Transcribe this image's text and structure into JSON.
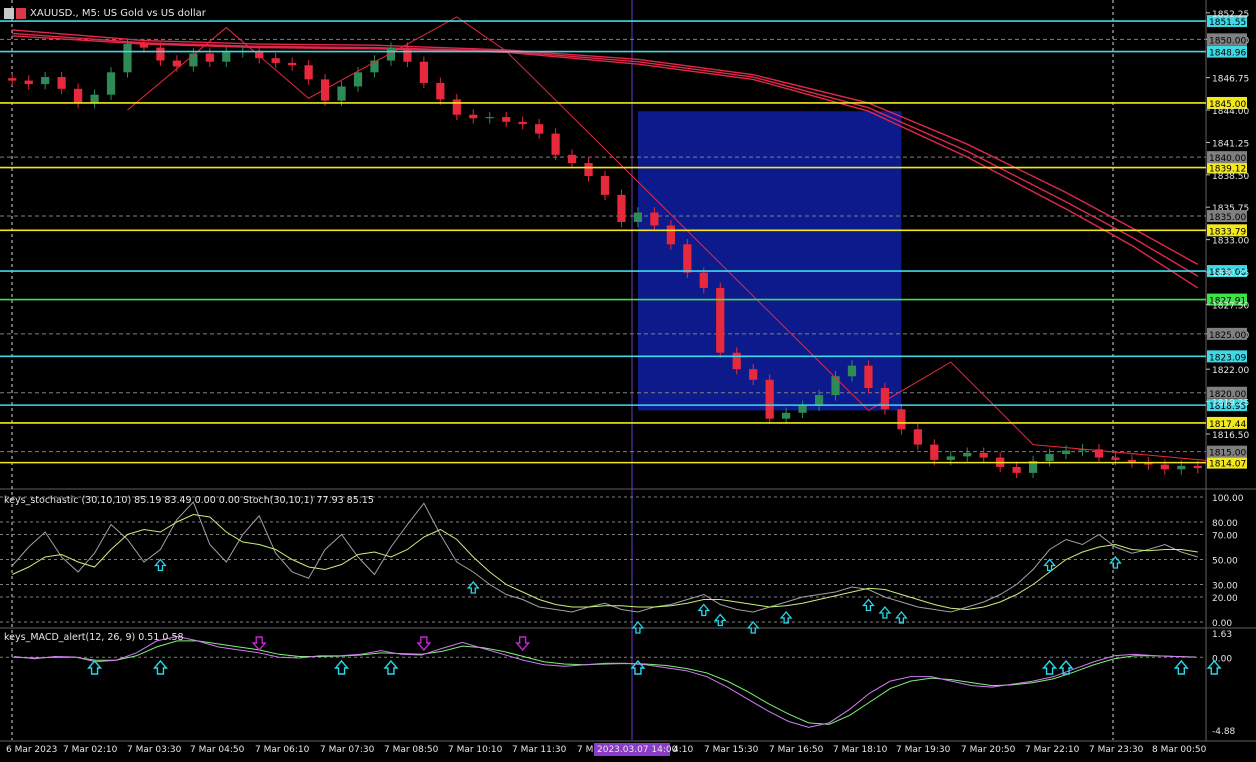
{
  "window": {
    "title": "XAUUSD., M5: US Gold vs US dollar"
  },
  "indicators": {
    "stochastic_label": "keys_stochastic (30,10,10) 85.19 83.49 0.00 0.00 Stoch(30,10,1) 77.93 85.15",
    "macd_label": "keys_MACD_alert(12, 26, 9) 0.51 0.58"
  },
  "time_axis": {
    "labels": [
      "6 Mar 2023",
      "7 Mar 02:10",
      "7 Mar 03:30",
      "7 Mar 04:50",
      "7 Mar 06:10",
      "7 Mar 07:30",
      "7 Mar 08:50",
      "7 Mar 10:10",
      "7 Mar 11:30",
      "7 Mar 1",
      "4:10",
      "7 Mar 15:30",
      "7 Mar 16:50",
      "7 Mar 18:10",
      "7 Mar 19:30",
      "7 Mar 20:50",
      "7 Mar 22:10",
      "7 Mar 23:30",
      "8 Mar 00:50"
    ],
    "crosshair_label": "2023.03.07 14:00"
  },
  "colors": {
    "background": "#000000",
    "bull": "#2e8b57",
    "bear": "#e8283c",
    "cyan_level": "#3fd9e6",
    "yellow_level": "#f2e81c",
    "green_level": "#3fe04a",
    "zone": "#0d1a8c",
    "ma": "#e0284a",
    "macd_line": "#d07cf0",
    "macd_signal": "#7ef07a",
    "stoch_main": "#a0a0a0",
    "stoch_signal": "#c8f07a",
    "arrow_up": "#27d8e8",
    "arrow_down": "#c327d0",
    "crosshair": "#6a3cc8"
  },
  "chart_data": {
    "type": "candlestick",
    "symbol": "XAUUSD.",
    "timeframe": "M5",
    "price_axis": {
      "range": [
        1812,
        1853
      ],
      "ticks": [
        "1852.25",
        "1850.00",
        "1846.75",
        "1844.00",
        "1841.25",
        "1838.50",
        "1835.75",
        "1833.00",
        "1830.25",
        "1827.50",
        "1825.00",
        "1822.00",
        "1819.25",
        "1816.50"
      ],
      "tick_values": [
        1852.25,
        1850.0,
        1846.75,
        1844.0,
        1841.25,
        1838.5,
        1835.75,
        1833.0,
        1830.25,
        1827.5,
        1825.0,
        1822.0,
        1819.25,
        1816.5
      ]
    },
    "levels": [
      {
        "price": 1851.55,
        "label": "1851.55",
        "color": "cyan"
      },
      {
        "price": 1848.96,
        "label": "1848.96",
        "color": "cyan"
      },
      {
        "price": 1844.6,
        "label": "1845.00",
        "color": "yellow"
      },
      {
        "price": 1839.12,
        "label": "1839.12",
        "color": "yellow"
      },
      {
        "price": 1833.79,
        "label": "1833.79",
        "color": "yellow"
      },
      {
        "price": 1830.33,
        "label": "1830.00",
        "color": "cyan"
      },
      {
        "price": 1827.91,
        "label": "1827.91",
        "color": "green"
      },
      {
        "price": 1823.09,
        "label": "1823.09",
        "color": "cyan"
      },
      {
        "price": 1818.95,
        "label": "1818.95",
        "color": "cyan"
      },
      {
        "price": 1817.44,
        "label": "1817.44",
        "color": "yellow"
      },
      {
        "price": 1814.07,
        "label": "1814.07",
        "color": "yellow"
      }
    ],
    "grey_labels": [
      {
        "price": 1850.0,
        "label": "1850.00"
      },
      {
        "price": 1840.0,
        "label": "1840.00"
      },
      {
        "price": 1835.0,
        "label": "1835.00"
      },
      {
        "price": 1825.0,
        "label": "1825.00"
      },
      {
        "price": 1820.0,
        "label": "1820.00"
      },
      {
        "price": 1815.0,
        "label": "1815.00"
      }
    ],
    "price_path": [
      1846.5,
      1846.2,
      1846.8,
      1845.8,
      1844.6,
      1845.3,
      1847.2,
      1849.6,
      1849.3,
      1848.2,
      1847.7,
      1848.8,
      1848.1,
      1848.9,
      1849.0,
      1848.4,
      1848.0,
      1847.8,
      1846.6,
      1844.8,
      1846.0,
      1847.2,
      1848.2,
      1849.3,
      1848.1,
      1846.3,
      1844.9,
      1843.6,
      1843.3,
      1843.4,
      1843.0,
      1842.8,
      1842.0,
      1840.2,
      1839.5,
      1838.4,
      1836.8,
      1834.5,
      1835.3,
      1834.2,
      1832.6,
      1830.2,
      1828.9,
      1823.4,
      1822.0,
      1821.1,
      1817.8,
      1818.3,
      1818.9,
      1819.8,
      1821.4,
      1822.3,
      1820.4,
      1818.6,
      1816.9,
      1815.6,
      1814.3,
      1814.6,
      1814.9,
      1814.5,
      1813.7,
      1813.2,
      1814.2,
      1814.8,
      1815.1,
      1815.2,
      1814.5,
      1814.3,
      1814.1,
      1813.9,
      1813.5,
      1813.8,
      1813.6
    ],
    "moving_averages": [
      {
        "name": "",
        "points": [
          [
            0,
            1850.3
          ],
          [
            8,
            1849.6
          ],
          [
            15,
            1849.3
          ],
          [
            22,
            1849.2
          ],
          [
            30,
            1848.9
          ],
          [
            38,
            1847.9
          ],
          [
            45,
            1846.6
          ],
          [
            52,
            1843.9
          ],
          [
            58,
            1840.0
          ],
          [
            64,
            1835.6
          ],
          [
            68,
            1832.5
          ],
          [
            72,
            1828.9
          ]
        ]
      },
      {
        "name": "",
        "points": [
          [
            0,
            1850.5
          ],
          [
            8,
            1849.7
          ],
          [
            15,
            1849.4
          ],
          [
            22,
            1849.3
          ],
          [
            30,
            1849.0
          ],
          [
            38,
            1848.1
          ],
          [
            45,
            1846.8
          ],
          [
            52,
            1844.2
          ],
          [
            58,
            1840.5
          ],
          [
            64,
            1836.2
          ],
          [
            68,
            1833.2
          ],
          [
            72,
            1829.9
          ]
        ]
      },
      {
        "name": "",
        "points": [
          [
            0,
            1850.8
          ],
          [
            8,
            1849.9
          ],
          [
            15,
            1849.6
          ],
          [
            22,
            1849.5
          ],
          [
            30,
            1849.1
          ],
          [
            38,
            1848.3
          ],
          [
            45,
            1847.0
          ],
          [
            52,
            1844.6
          ],
          [
            58,
            1841.1
          ],
          [
            64,
            1837.0
          ],
          [
            68,
            1834.0
          ],
          [
            72,
            1830.9
          ]
        ]
      }
    ],
    "zigzag": [
      [
        7,
        1844.0
      ],
      [
        13,
        1851.0
      ],
      [
        18,
        1845.0
      ],
      [
        27,
        1851.9
      ],
      [
        30,
        1849.0
      ],
      [
        52,
        1818.5
      ],
      [
        57,
        1822.6
      ],
      [
        62,
        1815.6
      ],
      [
        73,
        1814.2
      ]
    ],
    "zone": {
      "from_bar": 38,
      "to_bar": 54,
      "price_top": 1843.9,
      "price_bottom": 1818.5
    },
    "stochastic": {
      "levels": [
        "100.00",
        "80.00",
        "70.00",
        "50.00",
        "30.00",
        "20.00",
        "0.00"
      ],
      "level_values": [
        100,
        80,
        70,
        50,
        30,
        20,
        0
      ],
      "main": [
        45,
        60,
        72,
        52,
        40,
        55,
        78,
        66,
        48,
        58,
        82,
        96,
        62,
        48,
        70,
        85,
        55,
        40,
        35,
        58,
        70,
        52,
        38,
        60,
        78,
        95,
        70,
        48,
        40,
        30,
        22,
        18,
        12,
        10,
        8,
        12,
        15,
        10,
        8,
        12,
        14,
        18,
        22,
        14,
        10,
        8,
        12,
        16,
        20,
        22,
        24,
        28,
        26,
        20,
        16,
        12,
        10,
        8,
        12,
        16,
        22,
        30,
        42,
        58,
        66,
        62,
        70,
        60,
        55,
        58,
        62,
        56,
        52
      ],
      "signal": [
        38,
        44,
        52,
        54,
        48,
        44,
        58,
        70,
        74,
        72,
        80,
        86,
        84,
        72,
        64,
        62,
        58,
        50,
        44,
        42,
        46,
        54,
        56,
        52,
        58,
        68,
        74,
        66,
        52,
        40,
        30,
        24,
        18,
        14,
        12,
        12,
        13,
        13,
        12,
        12,
        13,
        15,
        18,
        18,
        16,
        14,
        12,
        13,
        15,
        18,
        21,
        24,
        27,
        26,
        22,
        18,
        14,
        11,
        10,
        12,
        16,
        22,
        30,
        40,
        50,
        56,
        60,
        62,
        58,
        57,
        58,
        58,
        56
      ]
    },
    "macd": {
      "levels": [
        "1.63",
        "0.00",
        "-4.88"
      ],
      "level_values": [
        1.63,
        0.0,
        -4.88
      ],
      "macd_line": [
        0.05,
        -0.1,
        0.05,
        0.02,
        -0.3,
        -0.2,
        0.3,
        1.1,
        1.4,
        1.1,
        0.7,
        0.5,
        0.3,
        0.0,
        -0.05,
        0.1,
        0.1,
        0.2,
        0.45,
        0.2,
        0.15,
        0.6,
        1.0,
        0.6,
        0.2,
        -0.2,
        -0.5,
        -0.6,
        -0.5,
        -0.4,
        -0.4,
        -0.5,
        -0.7,
        -0.9,
        -1.3,
        -2.0,
        -2.8,
        -3.6,
        -4.3,
        -4.7,
        -4.4,
        -3.5,
        -2.4,
        -1.6,
        -1.3,
        -1.3,
        -1.6,
        -1.9,
        -2.0,
        -1.8,
        -1.6,
        -1.3,
        -0.8,
        -0.3,
        0.1,
        0.2,
        0.1,
        0.05,
        0.0
      ],
      "signal_line": [
        0.0,
        -0.05,
        0.0,
        0.0,
        -0.2,
        -0.2,
        0.1,
        0.7,
        1.1,
        1.1,
        0.9,
        0.7,
        0.5,
        0.2,
        0.05,
        0.05,
        0.08,
        0.15,
        0.3,
        0.25,
        0.2,
        0.4,
        0.75,
        0.65,
        0.4,
        0.05,
        -0.3,
        -0.45,
        -0.5,
        -0.45,
        -0.42,
        -0.45,
        -0.55,
        -0.75,
        -1.05,
        -1.6,
        -2.3,
        -3.1,
        -3.8,
        -4.4,
        -4.5,
        -3.9,
        -3.0,
        -2.1,
        -1.6,
        -1.4,
        -1.5,
        -1.7,
        -1.9,
        -1.85,
        -1.7,
        -1.45,
        -1.0,
        -0.5,
        -0.1,
        0.1,
        0.1,
        0.05,
        0.02
      ]
    },
    "stoch_arrows": [
      9,
      28,
      38,
      42,
      43,
      45,
      47,
      52,
      53,
      54,
      63,
      67
    ],
    "macd_arrows_up": [
      5,
      9,
      20,
      23,
      38,
      63,
      64,
      71,
      73
    ],
    "macd_arrows_down": [
      15,
      25,
      31
    ]
  }
}
